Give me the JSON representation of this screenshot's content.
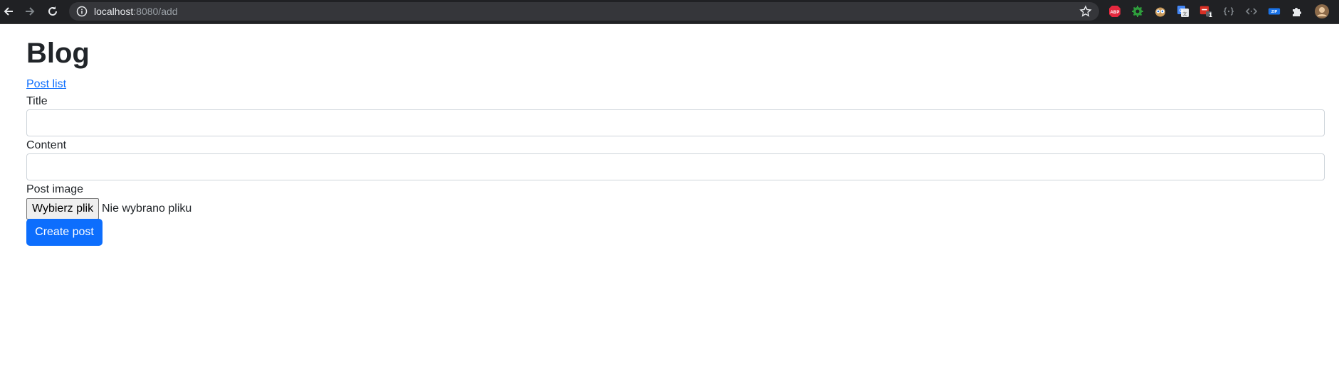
{
  "browser": {
    "url_host": "localhost",
    "url_rest": ":8080/add",
    "extension_badge": "1",
    "icons": [
      "back-arrow-icon",
      "forward-arrow-icon",
      "reload-icon",
      "info-icon",
      "bookmark-star-icon",
      "adblock-plus-icon",
      "green-gear-extension-icon",
      "owl-extension-icon",
      "google-translate-icon",
      "red-extension-icon",
      "json-extension-icon",
      "code-extension-icon",
      "zip-extension-icon",
      "puzzle-icon",
      "profile-avatar-icon"
    ]
  },
  "page": {
    "title": "Blog",
    "post_list_link": "Post list"
  },
  "form": {
    "title_label": "Title",
    "title_value": "",
    "content_label": "Content",
    "content_value": "",
    "image_label": "Post image",
    "file_button": "Wybierz plik",
    "file_status": "Nie wybrano pliku",
    "submit": "Create post"
  },
  "colors": {
    "primary": "#0d6efd",
    "text": "#212529",
    "browser_bg": "#202124"
  }
}
